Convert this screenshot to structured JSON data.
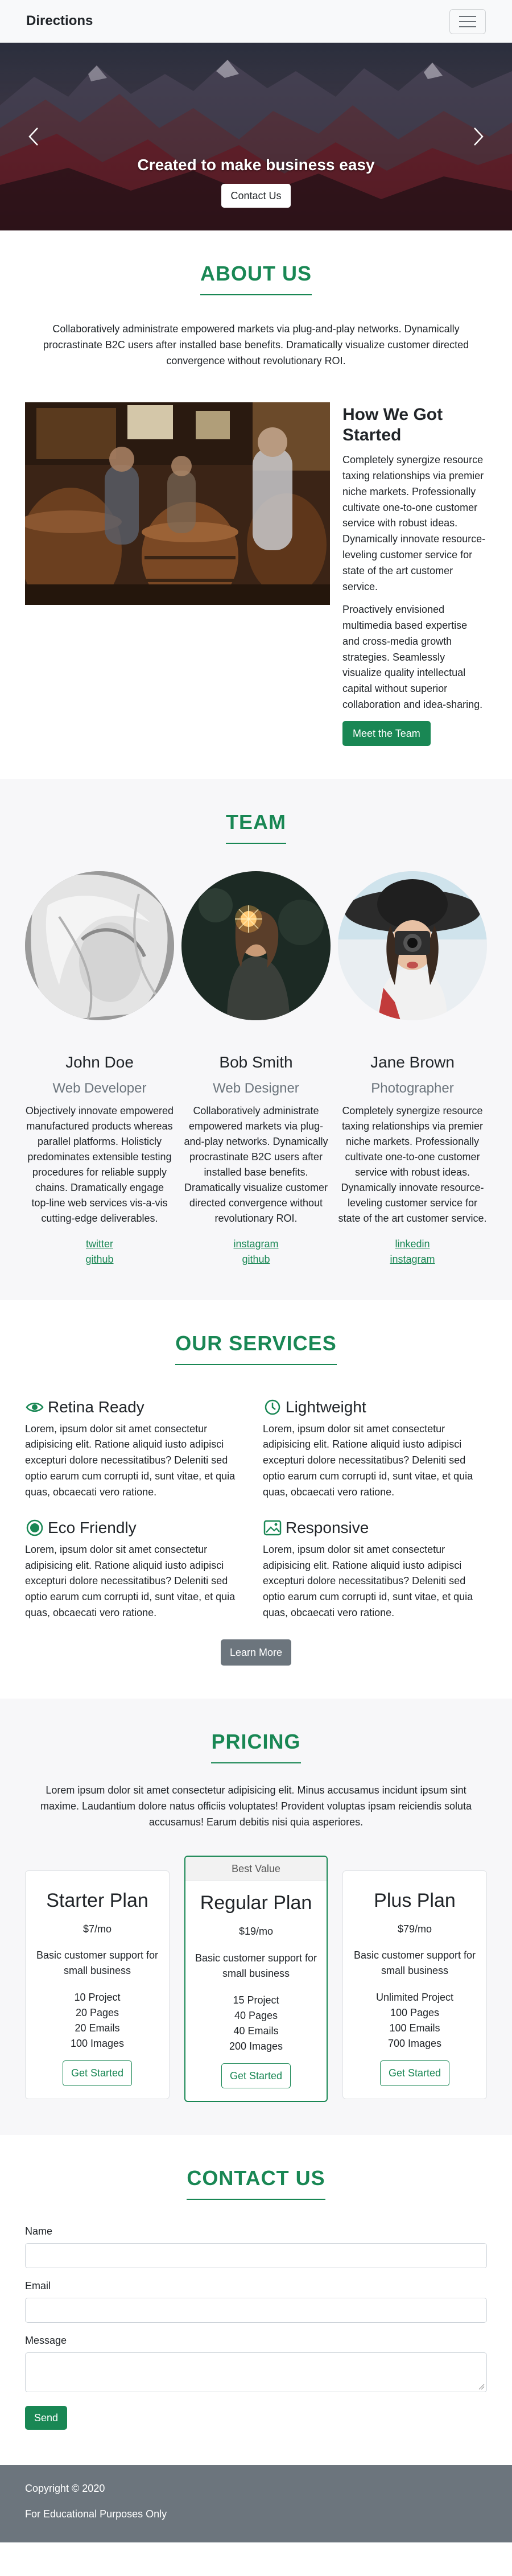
{
  "nav": {
    "brand": "Directions",
    "menu_icon": "hamburger-icon"
  },
  "hero": {
    "title": "Created to make business easy",
    "button": "Contact Us",
    "prev_icon": "chevron-left-icon",
    "next_icon": "chevron-right-icon"
  },
  "about": {
    "heading": "ABOUT US",
    "lead": "Collaboratively administrate empowered markets via plug-and-play networks. Dynamically procrastinate B2C users after installed base benefits. Dramatically visualize customer directed convergence without revolutionary ROI.",
    "subheading": "How We Got Started",
    "p1": "Completely synergize resource taxing relationships via premier niche markets. Professionally cultivate one-to-one customer service with robust ideas. Dynamically innovate resource-leveling customer service for state of the art customer service.",
    "p2": "Proactively envisioned multimedia based expertise and cross-media growth strategies. Seamlessly visualize quality intellectual capital without superior collaboration and idea-sharing.",
    "button": "Meet the Team"
  },
  "team": {
    "heading": "TEAM",
    "members": [
      {
        "name": "John Doe",
        "role": "Web Developer",
        "bio": "Objectively innovate empowered manufactured products whereas parallel platforms. Holisticly predominates extensible testing procedures for reliable supply chains. Dramatically engage top-line web services vis-a-vis cutting-edge deliverables.",
        "links": [
          "twitter",
          "github"
        ]
      },
      {
        "name": "Bob Smith",
        "role": "Web Designer",
        "bio": "Collaboratively administrate empowered markets via plug-and-play networks. Dynamically procrastinate B2C users after installed base benefits. Dramatically visualize customer directed convergence without revolutionary ROI.",
        "links": [
          "instagram",
          "github"
        ]
      },
      {
        "name": "Jane Brown",
        "role": "Photographer",
        "bio": "Completely synergize resource taxing relationships via premier niche markets. Professionally cultivate one-to-one customer service with robust ideas. Dynamically innovate resource-leveling customer service for state of the art customer service.",
        "links": [
          "linkedin",
          "instagram"
        ]
      }
    ]
  },
  "services": {
    "heading": "OUR SERVICES",
    "items": [
      {
        "title": "Retina Ready",
        "icon": "eye-icon",
        "text": "Lorem, ipsum dolor sit amet consectetur adipisicing elit. Ratione aliquid iusto adipisci excepturi dolore necessitatibus? Deleniti sed optio earum cum corrupti id, sunt vitae, et quia quas, obcaecati vero ratione."
      },
      {
        "title": "Lightweight",
        "icon": "clock-icon",
        "text": "Lorem, ipsum dolor sit amet consectetur adipisicing elit. Ratione aliquid iusto adipisci excepturi dolore necessitatibus? Deleniti sed optio earum cum corrupti id, sunt vitae, et quia quas, obcaecati vero ratione."
      },
      {
        "title": "Eco Friendly",
        "icon": "circle-check-icon",
        "text": "Lorem, ipsum dolor sit amet consectetur adipisicing elit. Ratione aliquid iusto adipisci excepturi dolore necessitatibus? Deleniti sed optio earum cum corrupti id, sunt vitae, et quia quas, obcaecati vero ratione."
      },
      {
        "title": "Responsive",
        "icon": "image-icon",
        "text": "Lorem, ipsum dolor sit amet consectetur adipisicing elit. Ratione aliquid iusto adipisci excepturi dolore necessitatibus? Deleniti sed optio earum cum corrupti id, sunt vitae, et quia quas, obcaecati vero ratione."
      }
    ],
    "button": "Learn More"
  },
  "pricing": {
    "heading": "PRICING",
    "lead": "Lorem ipsum dolor sit amet consectetur adipisicing elit. Minus accusamus incidunt ipsum sint maxime. Laudantium dolore natus officiis voluptates! Provident voluptas ipsam reiciendis soluta accusamus! Earum debitis nisi quia asperiores.",
    "plans": [
      {
        "name": "Starter Plan",
        "price": "$7/mo",
        "desc": "Basic customer support for small business",
        "features": [
          "10 Project",
          "20 Pages",
          "20 Emails",
          "100 Images"
        ],
        "button": "Get Started"
      },
      {
        "badge": "Best Value",
        "name": "Regular Plan",
        "price": "$19/mo",
        "desc": "Basic customer support for small business",
        "features": [
          "15 Project",
          "40 Pages",
          "40 Emails",
          "200 Images"
        ],
        "button": "Get Started"
      },
      {
        "name": "Plus Plan",
        "price": "$79/mo",
        "desc": "Basic customer support for small business",
        "features": [
          "Unlimited Project",
          "100 Pages",
          "100 Emails",
          "700 Images"
        ],
        "button": "Get Started"
      }
    ]
  },
  "contact": {
    "heading": "CONTACT US",
    "name_label": "Name",
    "email_label": "Email",
    "message_label": "Message",
    "button": "Send"
  },
  "footer": {
    "copyright": "Copyright © 2020",
    "note": "For Educational Purposes Only"
  },
  "colors": {
    "accent": "#198754",
    "muted": "#6c757d",
    "footer_bg": "#6c757d"
  }
}
